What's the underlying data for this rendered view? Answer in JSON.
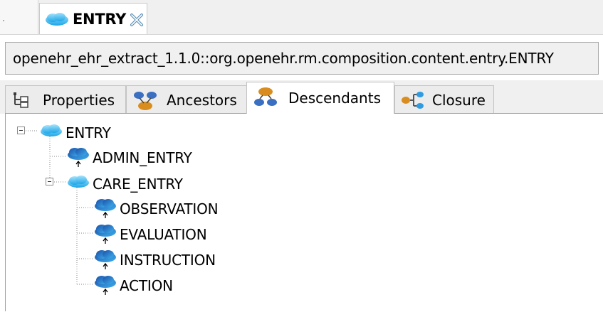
{
  "editor_tab": {
    "label": "ENTRY",
    "icon": "class-cloud-icon",
    "close_icon": "close-icon"
  },
  "path": {
    "value": "openehr_ehr_extract_1.1.0::org.openehr.rm.composition.content.entry.ENTRY"
  },
  "view_tabs": [
    {
      "label": "Properties",
      "icon": "properties-tree-icon",
      "active": false
    },
    {
      "label": "Ancestors",
      "icon": "ancestors-icon",
      "active": false
    },
    {
      "label": "Descendants",
      "icon": "descendants-icon",
      "active": true
    },
    {
      "label": "Closure",
      "icon": "closure-icon",
      "active": false
    }
  ],
  "tree": {
    "root": {
      "label": "ENTRY",
      "expanded": true,
      "icon": "class-cloud-icon"
    },
    "children": [
      {
        "label": "ADMIN_ENTRY",
        "icon": "descendant-class-icon"
      },
      {
        "label": "CARE_ENTRY",
        "icon": "class-cloud-icon",
        "expanded": true,
        "children": [
          {
            "label": "OBSERVATION",
            "icon": "descendant-class-icon"
          },
          {
            "label": "EVALUATION",
            "icon": "descendant-class-icon"
          },
          {
            "label": "INSTRUCTION",
            "icon": "descendant-class-icon"
          },
          {
            "label": "ACTION",
            "icon": "descendant-class-icon"
          }
        ]
      }
    ]
  },
  "colors": {
    "cloud_light": "#4fc3f0",
    "cloud_dark": "#1d5fb8",
    "accent_orange": "#e08a1a"
  }
}
